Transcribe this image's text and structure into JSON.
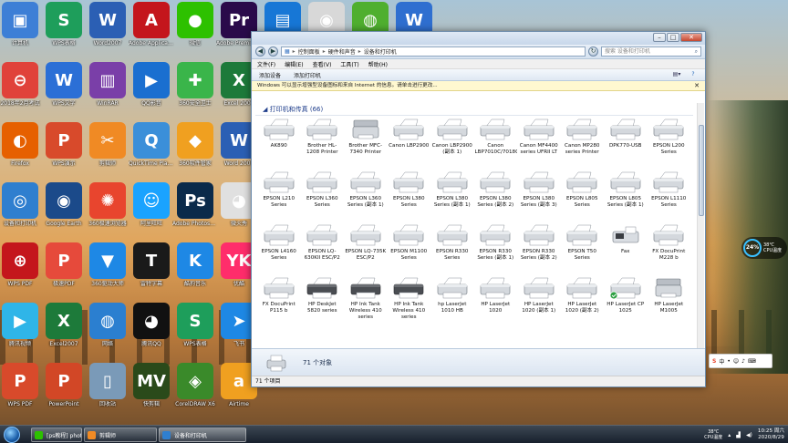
{
  "desktop": {
    "icons": [
      {
        "label": "计算机",
        "glyph": "▣",
        "color": "#3d7fd6"
      },
      {
        "label": "WPS表格",
        "glyph": "S",
        "color": "#1e9e5b"
      },
      {
        "label": "Word2007",
        "glyph": "W",
        "color": "#2b5fb4"
      },
      {
        "label": "Adobe Applicati...",
        "glyph": "A",
        "color": "#c4161c"
      },
      {
        "label": "微信",
        "glyph": "●",
        "color": "#2dc100"
      },
      {
        "label": "Adobe Premiere Pro CC 2019",
        "glyph": "Pr",
        "color": "#2a0a4a"
      },
      {
        "label": "",
        "glyph": "▤",
        "color": "#1777d6"
      },
      {
        "label": "",
        "glyph": "◉",
        "color": "#d8d8d8"
      },
      {
        "label": "",
        "glyph": "◍",
        "color": "#4faf2f"
      },
      {
        "label": "",
        "glyph": "W",
        "color": "#2f6fd0"
      },
      {
        "label": "2018年2月考试",
        "glyph": "⊖",
        "color": "#e0423a"
      },
      {
        "label": "WPS文字",
        "glyph": "W",
        "color": "#2b6fd6"
      },
      {
        "label": "WinRAR",
        "glyph": "▥",
        "color": "#7a3fa8"
      },
      {
        "label": "QQ影音",
        "glyph": "▶",
        "color": "#1a6fd0"
      },
      {
        "label": "360安全卫士",
        "glyph": "✚",
        "color": "#3ab54a"
      },
      {
        "label": "Excel 2007",
        "glyph": "X",
        "color": "#1d7a3a"
      },
      {
        "label": "Firefox",
        "glyph": "◐",
        "color": "#e66000"
      },
      {
        "label": "WPS演示",
        "glyph": "P",
        "color": "#d84a2b"
      },
      {
        "label": "剪辑师",
        "glyph": "✂",
        "color": "#f08a24"
      },
      {
        "label": "QuickTime Player",
        "glyph": "Q",
        "color": "#3b8fd9"
      },
      {
        "label": "360软件管家",
        "glyph": "◆",
        "color": "#f0a020"
      },
      {
        "label": "Word 2007",
        "glyph": "W",
        "color": "#2b5fb4"
      },
      {
        "label": "设备和打印机",
        "glyph": "◎",
        "color": "#2f7fcf"
      },
      {
        "label": "Google Earth",
        "glyph": "◉",
        "color": "#1b4a8a"
      },
      {
        "label": "360极速浏览器",
        "glyph": "✺",
        "color": "#e8452e"
      },
      {
        "label": "阿里旺旺",
        "glyph": "☺",
        "color": "#1aa3ff"
      },
      {
        "label": "Adobe Photoshop",
        "glyph": "Ps",
        "color": "#0a2a4a"
      },
      {
        "label": "微火秀",
        "glyph": "◕",
        "color": "#e0e0e0"
      },
      {
        "label": "WPS PDF",
        "glyph": "⊕",
        "color": "#c4161c"
      },
      {
        "label": "极速PDF",
        "glyph": "P",
        "color": "#e64a3b"
      },
      {
        "label": "360驱动大师",
        "glyph": "▼",
        "color": "#1e88e5"
      },
      {
        "label": "雷特字幕",
        "glyph": "T",
        "color": "#1a1a1a"
      },
      {
        "label": "酷狗音乐",
        "glyph": "K",
        "color": "#1e88e5"
      },
      {
        "label": "优酷",
        "glyph": "YK",
        "color": "#ff2d6b"
      },
      {
        "label": "腾讯视频",
        "glyph": "▶",
        "color": "#2fb5e8"
      },
      {
        "label": "Excel2007",
        "glyph": "X",
        "color": "#1d7a3a"
      },
      {
        "label": "网络",
        "glyph": "◍",
        "color": "#2b7fd0"
      },
      {
        "label": "腾讯QQ",
        "glyph": "◕",
        "color": "#111"
      },
      {
        "label": "WPS表格",
        "glyph": "S",
        "color": "#1e9e5b"
      },
      {
        "label": "飞书",
        "glyph": "➤",
        "color": "#1e88e5"
      },
      {
        "label": "WPS PDF",
        "glyph": "P",
        "color": "#d84a2b"
      },
      {
        "label": "PowerPoint",
        "glyph": "P",
        "color": "#d24726"
      },
      {
        "label": "回收站",
        "glyph": "▯",
        "color": "#7a9ab8"
      },
      {
        "label": "快剪辑",
        "glyph": "MV",
        "color": "#2a4a1a"
      },
      {
        "label": "CorelDRAW X6",
        "glyph": "◈",
        "color": "#3a8a2a"
      },
      {
        "label": "Airtime",
        "glyph": "a",
        "color": "#f0a020"
      }
    ]
  },
  "window": {
    "title": "",
    "controls": {
      "minimize": "–",
      "maximize": "□",
      "close": "✕"
    },
    "breadcrumb": [
      "控制面板",
      "硬件和声音",
      "设备和打印机"
    ],
    "search_placeholder": "搜索 设备和打印机",
    "menu": [
      "文件(F)",
      "编辑(E)",
      "查看(V)",
      "工具(T)",
      "帮助(H)"
    ],
    "commands": [
      "添加设备",
      "添加打印机"
    ],
    "infobar": "Windows 可以显示增强型设备图标和来自 Internet 的信息。请单击进行更改...",
    "infobar_close": "✕",
    "group_header": "◢ 打印机和传真 (66)",
    "devices": [
      {
        "name": "AK890",
        "kind": "printer"
      },
      {
        "name": "Brother HL-1208 Printer",
        "kind": "printer"
      },
      {
        "name": "Brother MFC-7340 Printer",
        "kind": "mfp"
      },
      {
        "name": "Canon LBP2900",
        "kind": "printer"
      },
      {
        "name": "Canon LBP2900 (副本 1)",
        "kind": "printer"
      },
      {
        "name": "Canon LBP7010C/7018C",
        "kind": "printer"
      },
      {
        "name": "Canon MF4400 series UFRII LT",
        "kind": "printer"
      },
      {
        "name": "Canon MP280 series Printer",
        "kind": "printer"
      },
      {
        "name": "DPK770-USB",
        "kind": "printer"
      },
      {
        "name": "EPSON L200 Series",
        "kind": "printer"
      },
      {
        "name": "EPSON L210 Series",
        "kind": "printer"
      },
      {
        "name": "EPSON L360 Series",
        "kind": "printer"
      },
      {
        "name": "EPSON L360 Series (副本 1)",
        "kind": "printer"
      },
      {
        "name": "EPSON L380 Series",
        "kind": "printer"
      },
      {
        "name": "EPSON L380 Series (副本 1)",
        "kind": "printer"
      },
      {
        "name": "EPSON L380 Series (副本 2)",
        "kind": "printer"
      },
      {
        "name": "EPSON L380 Series (副本 3)",
        "kind": "printer"
      },
      {
        "name": "EPSON L805 Series",
        "kind": "printer"
      },
      {
        "name": "EPSON L805 Series (副本 1)",
        "kind": "printer"
      },
      {
        "name": "EPSON L1110 Series",
        "kind": "printer"
      },
      {
        "name": "EPSON L4160 Series",
        "kind": "printer"
      },
      {
        "name": "EPSON LQ-630KII ESC/P2",
        "kind": "printer"
      },
      {
        "name": "EPSON LQ-735K ESC/P2",
        "kind": "printer"
      },
      {
        "name": "EPSON M1100 Series",
        "kind": "printer"
      },
      {
        "name": "EPSON R330 Series",
        "kind": "printer"
      },
      {
        "name": "EPSON R330 Series (副本 1)",
        "kind": "printer"
      },
      {
        "name": "EPSON R330 Series (副本 2)",
        "kind": "printer"
      },
      {
        "name": "EPSON T50 Series",
        "kind": "printer"
      },
      {
        "name": "Fax",
        "kind": "fax"
      },
      {
        "name": "FX DocuPrint M228 b",
        "kind": "printer"
      },
      {
        "name": "FX DocuPrint P115 b",
        "kind": "printer"
      },
      {
        "name": "HP DeskJet 5820 series",
        "kind": "dark"
      },
      {
        "name": "HP Ink Tank Wireless 410 series",
        "kind": "dark"
      },
      {
        "name": "HP Ink Tank Wireless 410 series",
        "kind": "dark"
      },
      {
        "name": "hp LaserJet 1010 HB",
        "kind": "printer"
      },
      {
        "name": "HP LaserJet 1020",
        "kind": "printer"
      },
      {
        "name": "HP LaserJet 1020 (副本 1)",
        "kind": "printer"
      },
      {
        "name": "HP LaserJet 1020 (副本 2)",
        "kind": "printer"
      },
      {
        "name": "HP LaserJet CP 1025",
        "kind": "default"
      },
      {
        "name": "HP LaserJet M1005",
        "kind": "mfp"
      }
    ],
    "detail_count": "71 个对象",
    "status_text": "71 个项目"
  },
  "taskbar": {
    "buttons": [
      {
        "label": "[ps教程] phot...",
        "color": "#2dc100"
      },
      {
        "label": "剪辑师",
        "color": "#f08a24"
      },
      {
        "label": "设备和打印机",
        "color": "#2f7fcf"
      }
    ],
    "cpu_temp": "38℃",
    "cpu_label": "CPU温度",
    "time": "10:25 周六",
    "date": "2020/8/29"
  },
  "widgets": {
    "cpu_percent": "24%",
    "cpu_temp": "38℃",
    "cpu_label": "CPU温度"
  }
}
